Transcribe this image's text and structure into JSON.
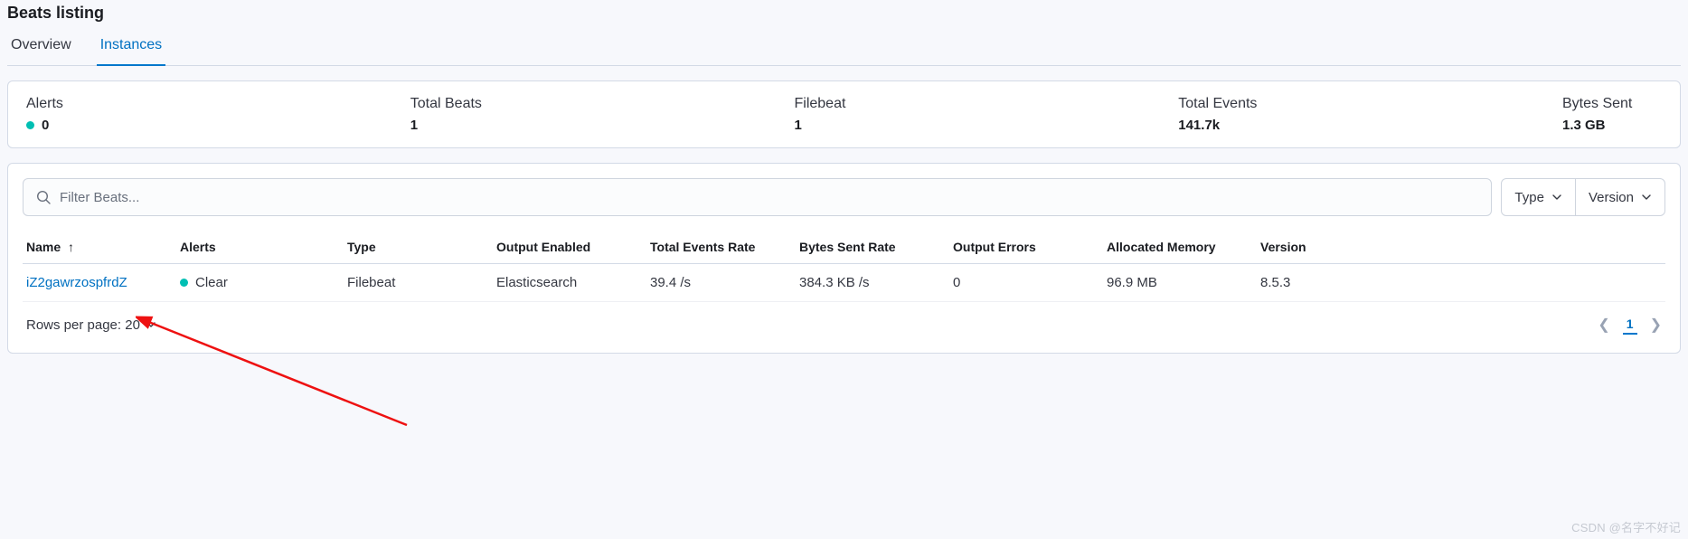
{
  "header": {
    "title": "Beats listing",
    "tabs": [
      {
        "label": "Overview",
        "active": false
      },
      {
        "label": "Instances",
        "active": true
      }
    ]
  },
  "stats": [
    {
      "label": "Alerts",
      "value": "0",
      "dot": true
    },
    {
      "label": "Total Beats",
      "value": "1"
    },
    {
      "label": "Filebeat",
      "value": "1"
    },
    {
      "label": "Total Events",
      "value": "141.7k"
    },
    {
      "label": "Bytes Sent",
      "value": "1.3 GB"
    }
  ],
  "toolbar": {
    "search_placeholder": "Filter Beats...",
    "filter_type": "Type",
    "filter_version": "Version"
  },
  "table": {
    "columns": {
      "name": "Name",
      "alerts": "Alerts",
      "type": "Type",
      "output_enabled": "Output Enabled",
      "total_events_rate": "Total Events Rate",
      "bytes_sent_rate": "Bytes Sent Rate",
      "output_errors": "Output Errors",
      "allocated_memory": "Allocated Memory",
      "version": "Version"
    },
    "rows": [
      {
        "name": "iZ2gawrzospfrdZ",
        "alerts": "Clear",
        "type": "Filebeat",
        "output_enabled": "Elasticsearch",
        "total_events_rate": "39.4 /s",
        "bytes_sent_rate": "384.3 KB /s",
        "output_errors": "0",
        "allocated_memory": "96.9 MB",
        "version": "8.5.3"
      }
    ]
  },
  "footer": {
    "rows_per_page": "Rows per page: 20",
    "current_page": "1"
  },
  "watermark": "CSDN @名字不好记"
}
